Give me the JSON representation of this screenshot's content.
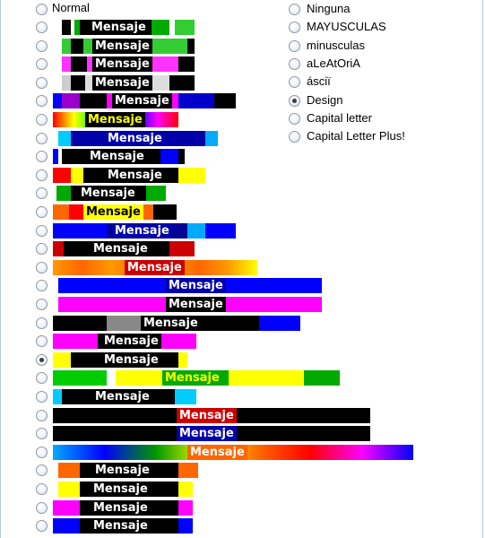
{
  "left_options": {
    "first_label": "Normal",
    "first_selected": false,
    "banner_text": "Mensaje",
    "selected_index": 19,
    "styles": [
      {
        "bg": "linear-gradient(90deg,#fff 0 10px,#000 10px 20px,#fff 20px 24px,#0a0 24px 30px,#000 30px 110px,#0a0 110px 130px,#fff 130px 136px,#3c3 136px)",
        "msgLeft": 40,
        "msgBg": "#000",
        "msgColor": "#fff",
        "width": 158
      },
      {
        "bg": "linear-gradient(90deg,#fff 0 10px,#3c3 10px 20px,#000 20px 34px,#3c3 34px 150px,#000 150px)",
        "msgLeft": 44,
        "msgBg": "#000",
        "msgColor": "#fff",
        "width": 158
      },
      {
        "bg": "linear-gradient(90deg,#fff 0 10px,#f3f 10px 20px,#000 20px 38px,#f3f 38px 140px,#000 140px)",
        "msgLeft": 44,
        "msgBg": "#000",
        "msgColor": "#fff",
        "width": 158
      },
      {
        "bg": "linear-gradient(90deg,#fff 0 10px,#ccc 10px 20px,#000 20px 36px,#ddd 36px 130px,#000 130px)",
        "msgLeft": 44,
        "msgBg": "#000",
        "msgColor": "#fff",
        "width": 158
      },
      {
        "bg": "linear-gradient(90deg,#00f 0 10px,#90c 10px 30px,#000 30px 60px,#f0f 60px 140px,#00c 140px 180px,#000 180px)",
        "msgLeft": 66,
        "msgBg": "#000",
        "msgColor": "#fff",
        "width": 204
      },
      {
        "bg": "linear-gradient(90deg,#f00,#ff0,#0f0,#0ff,#00f,#f0f,#f00)",
        "msgLeft": 36,
        "msgBg": "#000",
        "msgColor": "#ff0",
        "width": 140
      },
      {
        "bg": "linear-gradient(90deg,#fff 0 6px,#0cf 6px 20px,#00a 20px 170px,#0af 170px 184px,#fff 184px)",
        "msgLeft": 58,
        "msgBg": "#00a",
        "msgColor": "#fff",
        "width": 188
      },
      {
        "bg": "linear-gradient(90deg,#00f 0 6px,#fff 6px 10px,#000 10px 120px,#00f 120px 140px,#000 140px)",
        "msgLeft": 38,
        "msgBg": "#000",
        "msgColor": "#fff",
        "width": 147
      },
      {
        "bg": "linear-gradient(90deg,#f00 0 20px,#ff0 20px 34px,#000 34px 140px,#ff0 140px 170px,#fff 170px)",
        "msgLeft": 58,
        "msgBg": "#000",
        "msgColor": "#fff",
        "width": 186
      },
      {
        "bg": "linear-gradient(90deg,#fff 0 4px,#0a0 4px 20px,#000 20px 104px,#0a0 104px 126px,#fff 126px)",
        "msgLeft": 28,
        "msgBg": "#000",
        "msgColor": "#fff",
        "width": 130
      },
      {
        "bg": "linear-gradient(90deg,#f60 0 18px,#f00 18px 34px,#000 34px 100px,#f60 100px 112px,#000 112px)",
        "msgLeft": 34,
        "msgBg": "#ff0",
        "msgColor": "#000",
        "width": 138
      },
      {
        "bg": "linear-gradient(90deg,#00f 0 60px,#009 60px 150px,#0af 150px 170px,#00f 170px)",
        "msgLeft": 66,
        "msgBg": "#00a",
        "msgColor": "#fff",
        "width": 204
      },
      {
        "bg": "linear-gradient(90deg,#c00 0 12px,#000 12px 130px,#c00 130px 160px,#000 160px)",
        "msgLeft": 42,
        "msgBg": "#000",
        "msgColor": "#fff",
        "width": 158
      },
      {
        "bg": "linear-gradient(90deg,#f90,#f60,#f90,#f60,#f90,#f60,#f90,#ff0)",
        "msgLeft": 80,
        "msgBg": "#c00",
        "msgColor": "#fff",
        "width": 228
      },
      {
        "bg": "linear-gradient(90deg,#fff 0 6px,#00f 6px 300px,#fff 300px)",
        "msgLeft": 126,
        "msgBg": "#00a",
        "msgColor": "#fff",
        "width": 316
      },
      {
        "bg": "linear-gradient(90deg,#fff 0 6px,#f0f 6px 300px,#fff 300px)",
        "msgLeft": 126,
        "msgBg": "#000",
        "msgColor": "#fff",
        "width": 316
      },
      {
        "bg": "linear-gradient(90deg,#000 0 60px,#888 60px 150px,#000 150px 230px,#00f 230px)",
        "msgLeft": 98,
        "msgBg": "#000",
        "msgColor": "#fff",
        "width": 276
      },
      {
        "bg": "linear-gradient(90deg,#f0f 0 50px,#000 50px 120px,#f0f 120px 160px,#fff 160px)",
        "msgLeft": 54,
        "msgBg": "#000",
        "msgColor": "#fff",
        "width": 172
      },
      {
        "bg": "linear-gradient(90deg,#ff0 0 20px,#000 20px 140px,#ff0 140px 150px,#fff 150px)",
        "msgLeft": 54,
        "msgBg": "#000",
        "msgColor": "#fff",
        "width": 156
      },
      {
        "bg": "linear-gradient(90deg,#0c0 0 60px,#fff 60px 70px,#ff0 70px 122px,#0a0 122px 196px,#ff0 196px 280px,#0a0 280px)",
        "msgLeft": 122,
        "msgBg": "#0a0",
        "msgColor": "#ff0",
        "width": 320
      },
      {
        "bg": "linear-gradient(90deg,#0cf 0 10px,#000 10px 136px,#0cf 136px 160px,#fff 160px)",
        "msgLeft": 44,
        "msgBg": "#000",
        "msgColor": "#fff",
        "width": 166
      },
      {
        "bg": "linear-gradient(90deg,#000 0 100%)",
        "msgLeft": 138,
        "msgBg": "#c00",
        "msgColor": "#fff",
        "width": 354
      },
      {
        "bg": "linear-gradient(90deg,#000 0 100%)",
        "msgLeft": 138,
        "msgBg": "#00a",
        "msgColor": "#fff",
        "width": 354
      },
      {
        "bg": "linear-gradient(90deg,#0af,#00f,#090,#ff0,#f60,#f00,#f0f,#00f)",
        "msgLeft": 150,
        "msgBg": "#f60",
        "msgColor": "#fff",
        "width": 402
      },
      {
        "bg": "linear-gradient(90deg,#fff 0 6px,#f60 6px 30px,#000 30px 140px,#f60 140px 162px,#fff 162px)",
        "msgLeft": 44,
        "msgBg": "#000",
        "msgColor": "#fff",
        "width": 162
      },
      {
        "bg": "linear-gradient(90deg,#fff 0 6px,#ff0 6px 30px,#000 30px 140px,#ff0 140px 156px,#fff 156px)",
        "msgLeft": 42,
        "msgBg": "#000",
        "msgColor": "#fff",
        "width": 156
      },
      {
        "bg": "linear-gradient(90deg,#f0f 0 30px,#000 30px 140px,#f0f 140px 156px,#fff 156px)",
        "msgLeft": 42,
        "msgBg": "#000",
        "msgColor": "#fff",
        "width": 156
      },
      {
        "bg": "linear-gradient(90deg,#00f 0 30px,#000 30px 140px,#00f 140px 156px,#fff 156px)",
        "msgLeft": 42,
        "msgBg": "#000",
        "msgColor": "#fff",
        "width": 156
      }
    ]
  },
  "right_options": {
    "items": [
      {
        "label": "Ninguna",
        "selected": false
      },
      {
        "label": "MAYUSCULAS",
        "selected": false
      },
      {
        "label": "minusculas",
        "selected": false
      },
      {
        "label": "aLeAtOriA",
        "selected": false
      },
      {
        "label": "ásciï",
        "selected": false
      },
      {
        "label": "Design",
        "selected": true
      },
      {
        "label": "Capital letter",
        "selected": false
      },
      {
        "label": "Capital Letter Plus!",
        "selected": false
      }
    ]
  }
}
